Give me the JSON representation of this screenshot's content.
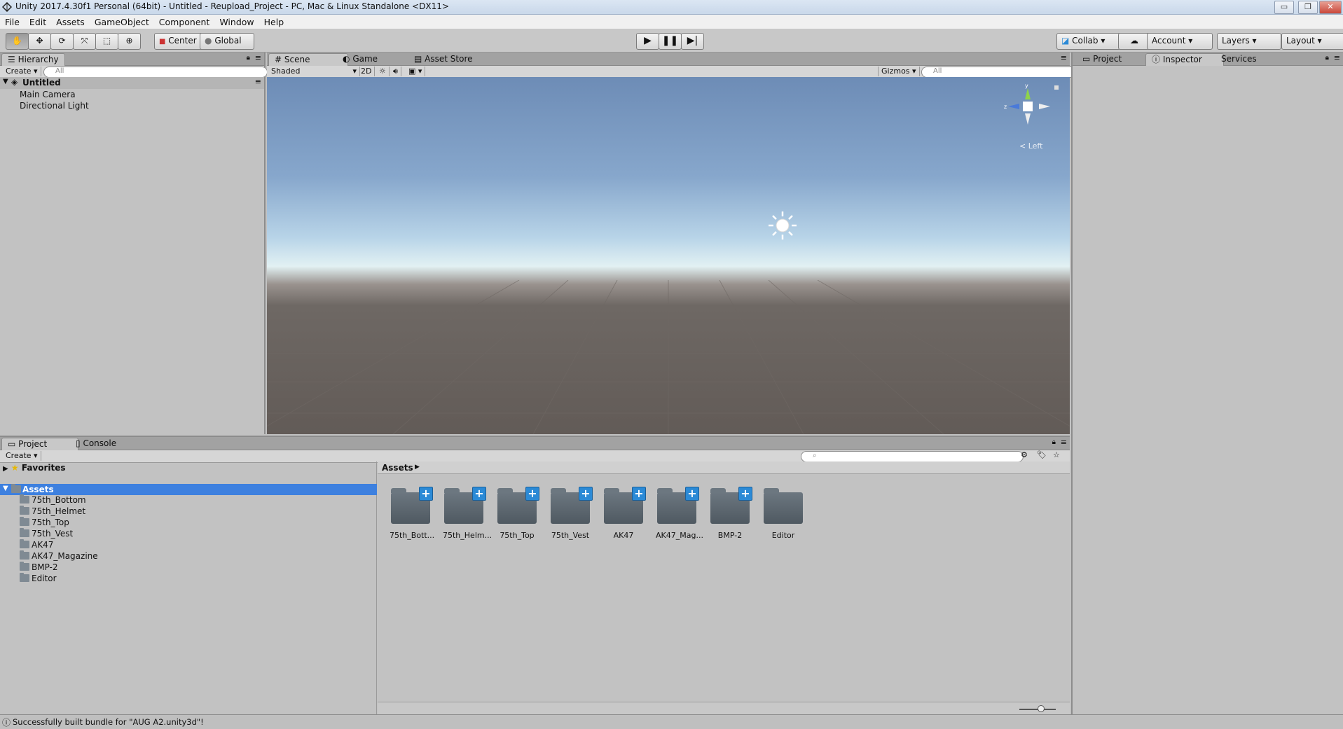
{
  "window": {
    "title": "Unity 2017.4.30f1 Personal (64bit) - Untitled - Reupload_Project - PC, Mac & Linux Standalone <DX11>",
    "minimize": "▭",
    "maximize": "❐",
    "close": "✕"
  },
  "menu": [
    "File",
    "Edit",
    "Assets",
    "GameObject",
    "Component",
    "Window",
    "Help"
  ],
  "toolbar": {
    "pivot_label": "Center",
    "space_label": "Global",
    "collab_label": "Collab",
    "account_label": "Account",
    "layers_label": "Layers",
    "layout_label": "Layout"
  },
  "hierarchy": {
    "tab": "Hierarchy",
    "create": "Create",
    "search_placeholder": "All",
    "scene_name": "Untitled",
    "items": [
      "Main Camera",
      "Directional Light"
    ]
  },
  "scene": {
    "tabs": [
      "Scene",
      "Game",
      "Asset Store"
    ],
    "shading": "Shaded",
    "mode_2d": "2D",
    "gizmos": "Gizmos",
    "search_placeholder": "All",
    "view_label": "< Left",
    "gizmo_y": "y",
    "gizmo_z": "z"
  },
  "inspector": {
    "tabs": [
      "Project",
      "Inspector",
      "Services"
    ]
  },
  "project": {
    "tabs": [
      "Project",
      "Console"
    ],
    "create": "Create",
    "favorites": "Favorites",
    "assets_root": "Assets",
    "tree_items": [
      "75th_Bottom",
      "75th_Helmet",
      "75th_Top",
      "75th_Vest",
      "AK47",
      "AK47_Magazine",
      "BMP-2",
      "Editor"
    ],
    "breadcrumb": "Assets",
    "grid_items": [
      {
        "label": "75th_Bott...",
        "has_plus": true
      },
      {
        "label": "75th_Helm...",
        "has_plus": true
      },
      {
        "label": "75th_Top",
        "has_plus": true
      },
      {
        "label": "75th_Vest",
        "has_plus": true
      },
      {
        "label": "AK47",
        "has_plus": true
      },
      {
        "label": "AK47_Mag...",
        "has_plus": true
      },
      {
        "label": "BMP-2",
        "has_plus": true
      },
      {
        "label": "Editor",
        "has_plus": false
      }
    ]
  },
  "status": {
    "message": "Successfully built bundle for \"AUG A2.unity3d\"!"
  },
  "colors": {
    "selection": "#3d80df",
    "sky_top": "#6f8fb8",
    "ground": "#5d5652",
    "panel_bg": "#c2c2c2"
  }
}
